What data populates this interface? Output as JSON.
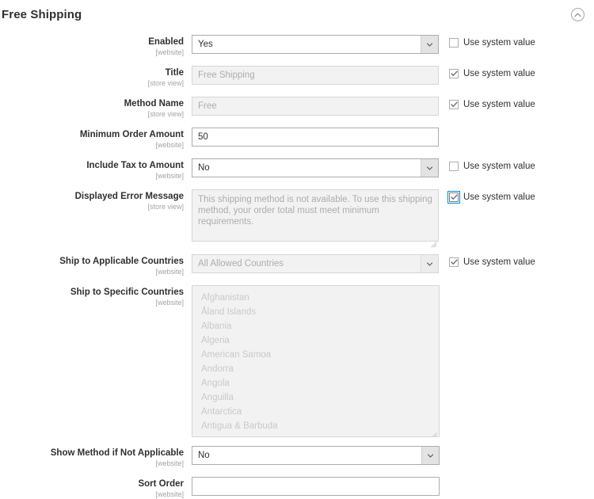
{
  "section": {
    "title": "Free Shipping",
    "collapse_icon": "chevron-up-circle-icon"
  },
  "system_value_label": "Use system value",
  "fields": [
    {
      "label": "Enabled",
      "scope": "[website]",
      "type": "select",
      "value": "Yes",
      "disabled": false,
      "has_system_value": true,
      "system_value_checked": false
    },
    {
      "label": "Title",
      "scope": "[store view]",
      "type": "text",
      "value": "Free Shipping",
      "disabled": true,
      "has_system_value": true,
      "system_value_checked": true
    },
    {
      "label": "Method Name",
      "scope": "[store view]",
      "type": "text",
      "value": "Free",
      "disabled": true,
      "has_system_value": true,
      "system_value_checked": true
    },
    {
      "label": "Minimum Order Amount",
      "scope": "[website]",
      "type": "text",
      "value": "50",
      "disabled": false,
      "has_system_value": false,
      "system_value_checked": false
    },
    {
      "label": "Include Tax to Amount",
      "scope": "[website]",
      "type": "select",
      "value": "No",
      "disabled": false,
      "has_system_value": true,
      "system_value_checked": false
    },
    {
      "label": "Displayed Error Message",
      "scope": "[store view]",
      "type": "textarea",
      "value": "This shipping method is not available. To use this shipping method, your order total must meet minimum requirements.",
      "disabled": true,
      "has_system_value": true,
      "system_value_checked": true,
      "system_value_focused": true
    },
    {
      "label": "Ship to Applicable Countries",
      "scope": "[website]",
      "type": "select",
      "value": "All Allowed Countries",
      "disabled": true,
      "has_system_value": true,
      "system_value_checked": true
    },
    {
      "label": "Ship to Specific Countries",
      "scope": "[website]",
      "type": "multiselect",
      "disabled": true,
      "has_system_value": false,
      "options": [
        "Afghanistan",
        "Åland Islands",
        "Albania",
        "Algeria",
        "American Samoa",
        "Andorra",
        "Angola",
        "Anguilla",
        "Antarctica",
        "Antigua & Barbuda"
      ]
    },
    {
      "label": "Show Method if Not Applicable",
      "scope": "[website]",
      "type": "select",
      "value": "No",
      "disabled": false,
      "has_system_value": false,
      "narrow": true
    },
    {
      "label": "Sort Order",
      "scope": "[website]",
      "type": "text",
      "value": "",
      "disabled": false,
      "has_system_value": false,
      "narrow": true
    }
  ],
  "colors": {
    "focus_blue": "#008bdb",
    "label_text": "#303030",
    "scope_text": "#a3a3a3",
    "disabled_bg": "#f2f2f2",
    "disabled_text": "#adadad"
  }
}
